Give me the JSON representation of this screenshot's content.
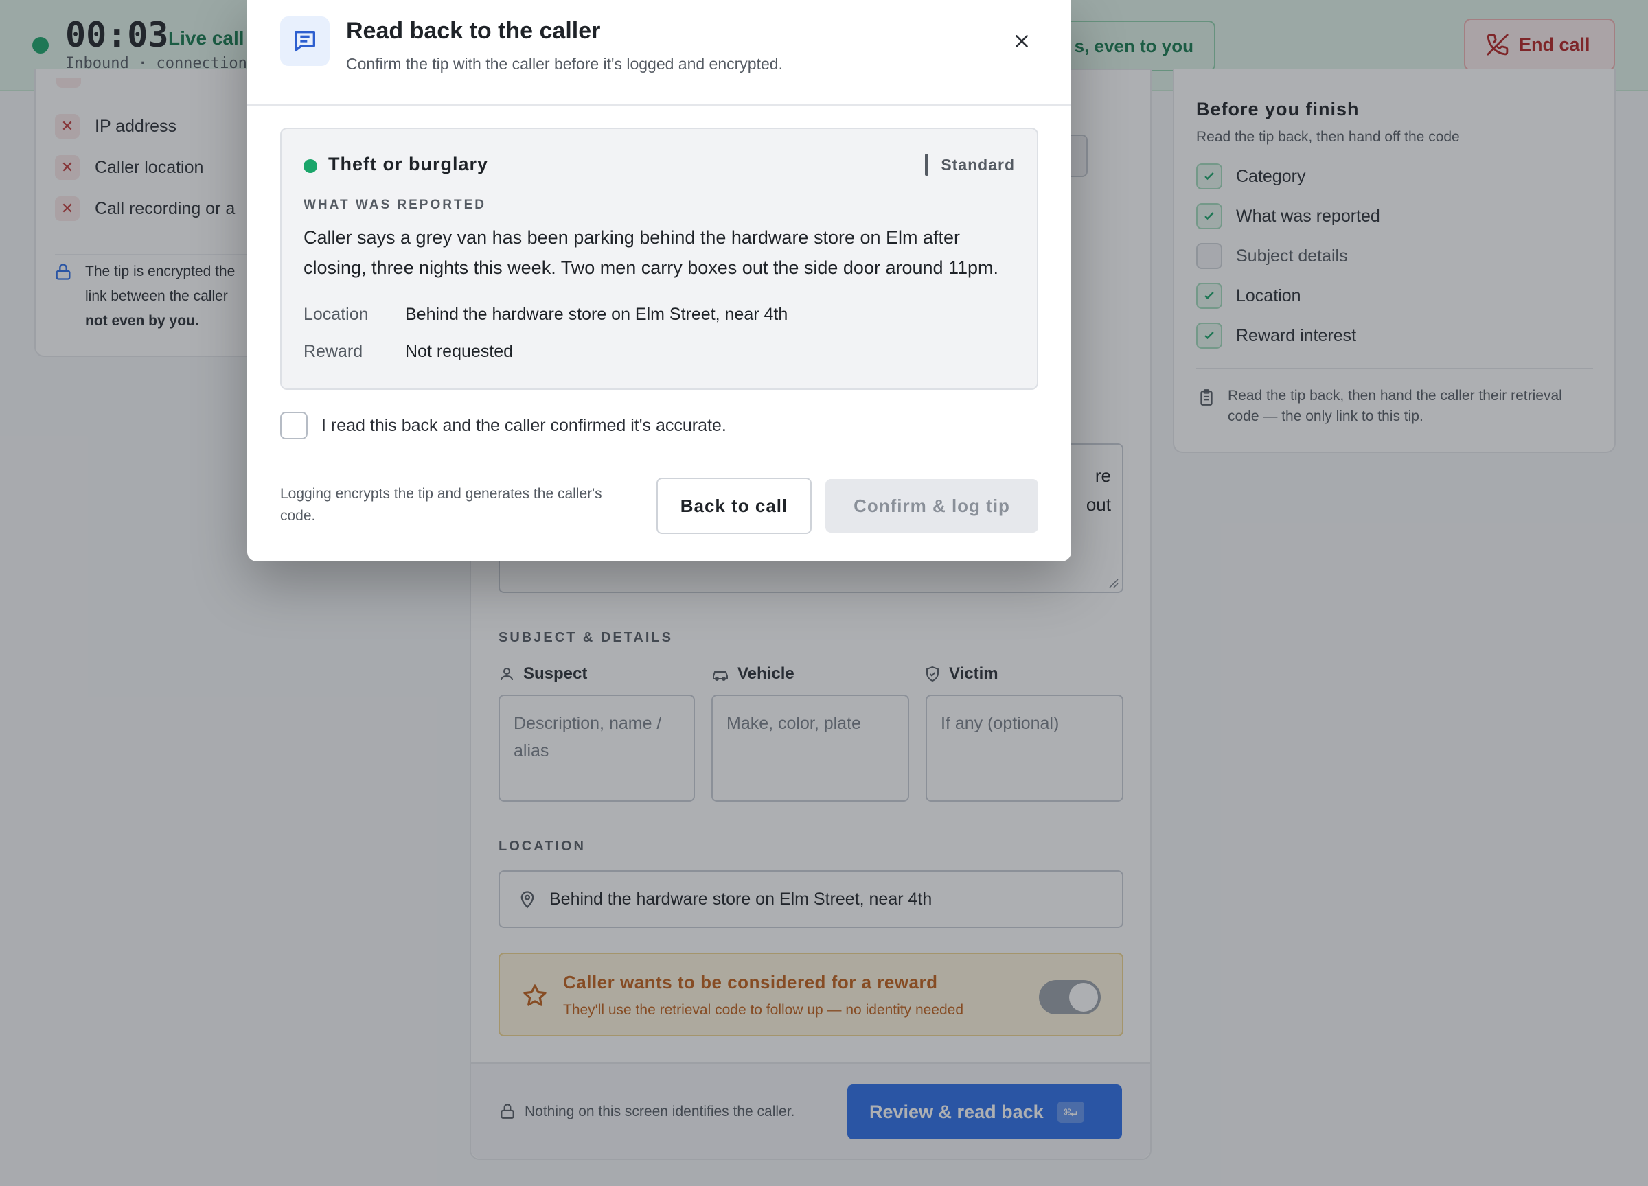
{
  "call": {
    "timer": "00:03",
    "status": "Live call",
    "subline": "Inbound · connection",
    "privacy_text": "s, even to you",
    "end_call_label": "End call"
  },
  "left_panel": {
    "not_collected": [
      "IP address",
      "Caller location",
      "Call recording or a"
    ],
    "encryption_note": {
      "line1": "The tip is encrypted the",
      "line2": "link between the caller",
      "bold": "not even by you."
    }
  },
  "form": {
    "narrative_fragments": [
      "re",
      "out"
    ],
    "subject_section_label": "SUBJECT & DETAILS",
    "subjects": [
      {
        "label": "Suspect",
        "icon": "person-icon",
        "placeholder": "Description, name / alias"
      },
      {
        "label": "Vehicle",
        "icon": "car-icon",
        "placeholder": "Make, color, plate"
      },
      {
        "label": "Victim",
        "icon": "shield-icon",
        "placeholder": "If any (optional)"
      }
    ],
    "location_section_label": "LOCATION",
    "location_value": "Behind the hardware store on Elm Street, near 4th",
    "reward": {
      "title": "Caller wants to be considered for a reward",
      "subtitle": "They'll use the retrieval code to follow up — no identity needed",
      "toggle_on": true
    },
    "footer_note": "Nothing on this screen identifies the caller.",
    "review_button": "Review & read back",
    "review_shortcut": "⌘↵"
  },
  "checklist": {
    "title": "Before you finish",
    "subtitle": "Read the tip back, then hand off the code",
    "items": [
      {
        "label": "Category",
        "done": true
      },
      {
        "label": "What was reported",
        "done": true
      },
      {
        "label": "Subject details",
        "done": false
      },
      {
        "label": "Location",
        "done": true
      },
      {
        "label": "Reward interest",
        "done": true
      }
    ],
    "note": "Read the tip back, then hand the caller their retrieval code — the only link to this tip."
  },
  "modal": {
    "title": "Read back to the caller",
    "subtitle": "Confirm the tip with the caller before it's logged and encrypted.",
    "category": "Theft or burglary",
    "priority": "Standard",
    "reported_label": "WHAT WAS REPORTED",
    "reported_text": "Caller says a grey van has been parking behind the hardware store on Elm after closing, three nights this week. Two men carry boxes out the side door around 11pm.",
    "location_key": "Location",
    "location_value": "Behind the hardware store on Elm Street, near 4th",
    "reward_key": "Reward",
    "reward_value": "Not requested",
    "confirm_text": "I read this back and the caller confirmed it's accurate.",
    "footnote": "Logging encrypts the tip and generates the caller's code.",
    "back_button": "Back to call",
    "log_button": "Confirm & log tip",
    "colors": {
      "category_dot": "#1aa56a",
      "accent": "#2d6fe8"
    }
  }
}
